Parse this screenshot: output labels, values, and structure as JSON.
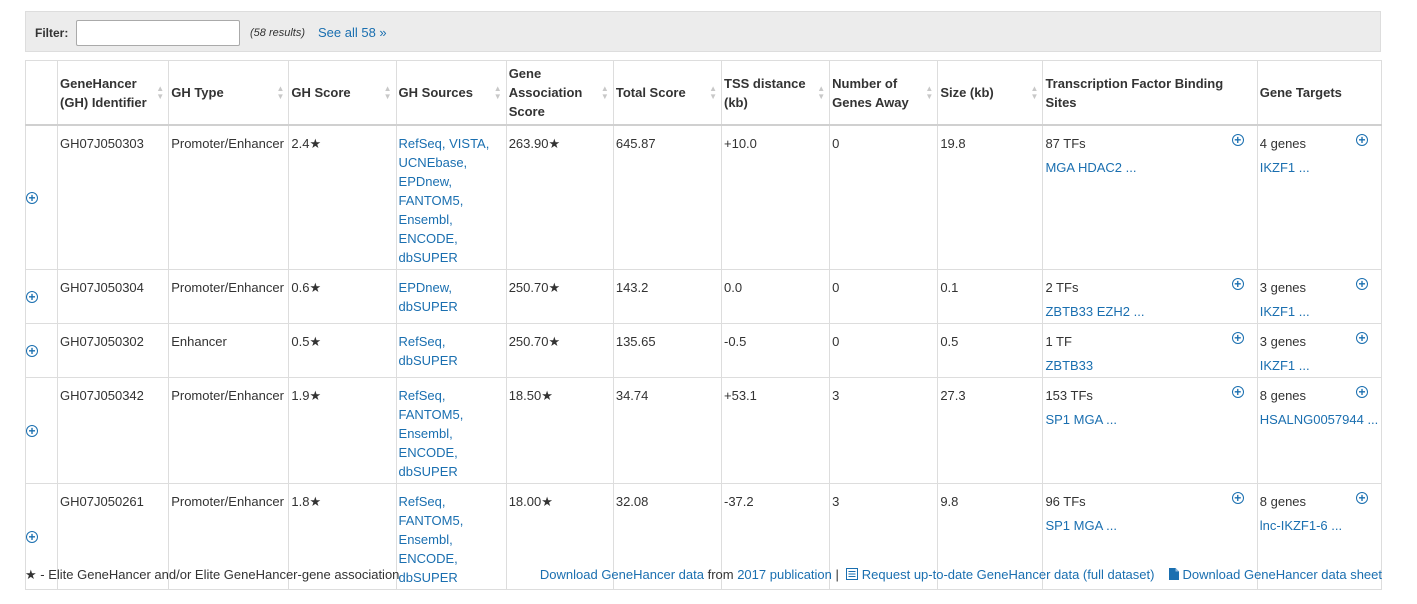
{
  "filter": {
    "label": "Filter:",
    "value": "",
    "placeholder": "",
    "results": "(58 results)",
    "see_all": "See all 58 »"
  },
  "columns": [
    "GeneHancer (GH) Identifier",
    "GH Type",
    "GH Score",
    "GH Sources",
    "Gene Association Score",
    "Total Score",
    "TSS distance (kb)",
    "Number of Genes Away",
    "Size (kb)",
    "Transcription Factor Binding Sites",
    "Gene Targets"
  ],
  "rows": [
    {
      "id": "GH07J050303",
      "type": "Promoter/Enhancer",
      "score": "2.4★",
      "sources": [
        "RefSeq, VISTA,",
        "UCNEbase,",
        "EPDnew,",
        "FANTOM5,",
        "Ensembl,",
        "ENCODE,",
        "dbSUPER"
      ],
      "assoc": "263.90★",
      "total": "645.87",
      "tss": "+10.0",
      "genes_away": "0",
      "size": "19.8",
      "tfbs_count": "87 TFs",
      "tfbs_list": "MGA HDAC2 ...",
      "targets_count": "4 genes",
      "targets_list": "IKZF1 ..."
    },
    {
      "id": "GH07J050304",
      "type": "Promoter/Enhancer",
      "score": "0.6★",
      "sources": [
        "EPDnew,",
        "dbSUPER"
      ],
      "assoc": "250.70★",
      "total": "143.2",
      "tss": "0.0",
      "genes_away": "0",
      "size": "0.1",
      "tfbs_count": "2 TFs",
      "tfbs_list": "ZBTB33 EZH2 ...",
      "targets_count": "3 genes",
      "targets_list": "IKZF1 ..."
    },
    {
      "id": "GH07J050302",
      "type": "Enhancer",
      "score": "0.5★",
      "sources": [
        "RefSeq,",
        "dbSUPER"
      ],
      "assoc": "250.70★",
      "total": "135.65",
      "tss": "-0.5",
      "genes_away": "0",
      "size": "0.5",
      "tfbs_count": "1 TF",
      "tfbs_list": "ZBTB33",
      "targets_count": "3 genes",
      "targets_list": "IKZF1 ..."
    },
    {
      "id": "GH07J050342",
      "type": "Promoter/Enhancer",
      "score": "1.9★",
      "sources": [
        "RefSeq,",
        "FANTOM5,",
        "Ensembl,",
        "ENCODE,",
        "dbSUPER"
      ],
      "assoc": "18.50★",
      "total": "34.74",
      "tss": "+53.1",
      "genes_away": "3",
      "size": "27.3",
      "tfbs_count": "153 TFs",
      "tfbs_list": "SP1 MGA ...",
      "targets_count": "8 genes",
      "targets_list": "HSALNG0057944 ..."
    },
    {
      "id": "GH07J050261",
      "type": "Promoter/Enhancer",
      "score": "1.8★",
      "sources": [
        "RefSeq,",
        "FANTOM5,",
        "Ensembl,",
        "ENCODE,",
        "dbSUPER"
      ],
      "assoc": "18.00★",
      "total": "32.08",
      "tss": "-37.2",
      "genes_away": "3",
      "size": "9.8",
      "tfbs_count": "96 TFs",
      "tfbs_list": "SP1 MGA ...",
      "targets_count": "8 genes",
      "targets_list": "lnc-IKZF1-6 ..."
    }
  ],
  "footer": {
    "note": "★ - Elite GeneHancer and/or Elite GeneHancer-gene association",
    "download_data": "Download GeneHancer data",
    "from_text": "from",
    "publication": "2017 publication",
    "separator": "|",
    "request": "Request up-to-date GeneHancer data (full dataset)",
    "download_sheet": "Download GeneHancer data sheet"
  },
  "icons": {
    "expand": "plus-circle-icon",
    "sort": "sort-icon",
    "list": "list-icon",
    "document": "document-icon"
  },
  "colors": {
    "link": "#1a6fb0",
    "border": "#dddddd",
    "filter_bg": "#ececec"
  }
}
